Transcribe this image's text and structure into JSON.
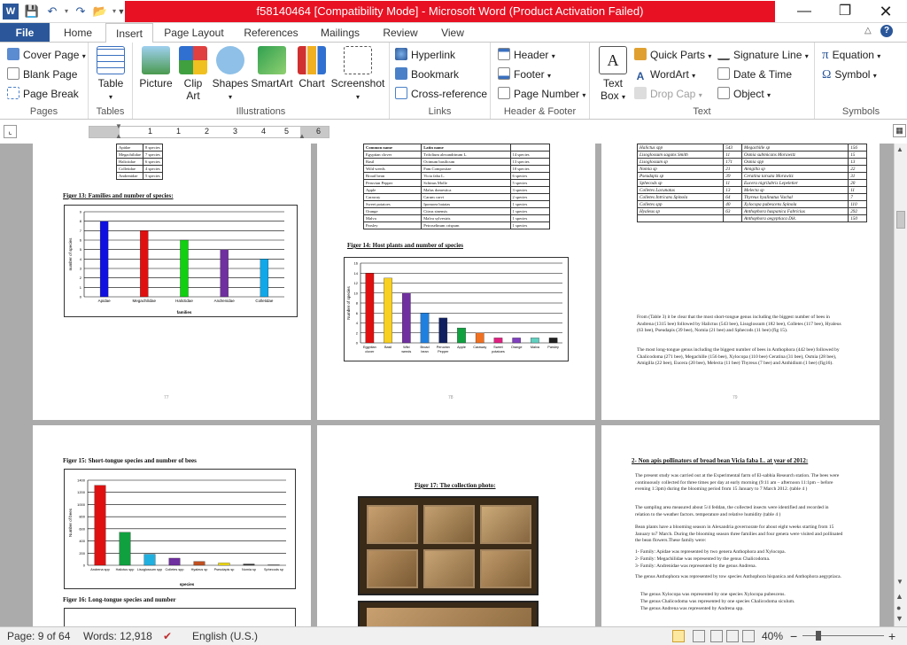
{
  "window": {
    "title": "f58140464 [Compatibility Mode]  -  Microsoft Word (Product Activation Failed)"
  },
  "tabs": {
    "file": "File",
    "items": [
      "Home",
      "Insert",
      "Page Layout",
      "References",
      "Mailings",
      "Review",
      "View"
    ],
    "active": "Insert"
  },
  "ribbon": {
    "pages": {
      "label": "Pages",
      "cover": "Cover Page",
      "blank": "Blank Page",
      "break": "Page Break"
    },
    "tables": {
      "label": "Tables",
      "table": "Table"
    },
    "illustrations": {
      "label": "Illustrations",
      "picture": "Picture",
      "clipart1": "Clip",
      "clipart2": "Art",
      "shapes": "Shapes",
      "smartart": "SmartArt",
      "chart": "Chart",
      "screenshot": "Screenshot"
    },
    "links": {
      "label": "Links",
      "hyperlink": "Hyperlink",
      "bookmark": "Bookmark",
      "crossref": "Cross-reference"
    },
    "headerfooter": {
      "label": "Header & Footer",
      "header": "Header",
      "footer": "Footer",
      "pagenumber": "Page Number"
    },
    "text": {
      "label": "Text",
      "textbox1": "Text",
      "textbox2": "Box",
      "quickparts": "Quick Parts",
      "wordart": "WordArt",
      "dropcap": "Drop Cap",
      "signature": "Signature Line",
      "datetime": "Date & Time",
      "object": "Object"
    },
    "symbols": {
      "label": "Symbols",
      "equation": "Equation",
      "symbol": "Symbol"
    }
  },
  "ruler": {
    "ticks": [
      "1",
      "1",
      "2",
      "3",
      "4",
      "5",
      "6"
    ]
  },
  "status": {
    "page": "Page: 9 of 64",
    "words": "Words: 12,918",
    "language": "English (U.S.)",
    "zoom": "40%"
  },
  "colors": {
    "accent": "#2b579a",
    "titlebar_alert": "#e81123"
  },
  "document": {
    "page1": {
      "fam_rows": [
        [
          "Apidae",
          "8 species"
        ],
        [
          "Megachilidae",
          "7 species"
        ],
        [
          "Halictidae",
          "6 species"
        ],
        [
          "Colletidae",
          "4 species"
        ],
        [
          "Andrenidae",
          "5 species"
        ]
      ],
      "fig13": "Figer  13: Families and number of species:",
      "fig13_y": "number of species",
      "fig13_x": "families",
      "num": "77"
    },
    "page2": {
      "table_head": [
        "Common  name",
        "Latin name",
        ""
      ],
      "table_rows": [
        [
          "Egyptian clover",
          "Trifolium alexandrinum L.",
          "14 species"
        ],
        [
          "Basil",
          "Ocimum basilicum",
          "13 species"
        ],
        [
          "Wild weeds",
          "Fam.Compositae",
          "10 species"
        ],
        [
          "Broad bean",
          "Vicia faba L.",
          "6 species"
        ],
        [
          "Peruvian Pepper",
          "Schinus Molle",
          "5 species"
        ],
        [
          "Apple",
          "Malus domestica",
          "3 species"
        ],
        [
          "Caraway",
          "Carum carvi",
          "2 species"
        ],
        [
          "Sweet potatoes",
          "Ipomoea batatas",
          "1 species"
        ],
        [
          "Orange",
          "Citrus sinensis",
          "1 species"
        ],
        [
          "Malva",
          "Malva sylvestris",
          "1 species"
        ],
        [
          "Parsley",
          "Petroselinum crispum",
          "1 species"
        ]
      ],
      "fig14": "Figer  14: Host plants and number of species",
      "fig14_y": "Number of species",
      "num": "78"
    },
    "page3": {
      "rows": [
        [
          "Halictus spp",
          "543",
          "Megachille sp",
          "156"
        ],
        [
          "Lisoglossum sagans  Smith",
          "11",
          "Osmia submicans  Morawitz",
          "15"
        ],
        [
          "Lisoglossum sp",
          "171",
          "Osmia spp",
          "13"
        ],
        [
          "Nomia sp",
          "21",
          "Amigilla sp",
          "22"
        ],
        [
          "Pseudapis sp",
          "39",
          "Ceratina tarsata  Morawitz",
          "31"
        ],
        [
          "Sphecods sp",
          "11",
          "Eucera nigrilabris Lepeletier",
          "20"
        ],
        [
          "Colletes Lacunatus",
          "13",
          "Melecta sp",
          "11"
        ],
        [
          "Colletes Intricans Spinola",
          "64",
          "Thyreus  hyalinatus  Vachal",
          "7"
        ],
        [
          "Colletes spp",
          "40",
          "Xylocopa pubescens  Spinola",
          "110"
        ],
        [
          "Hyaleus sp",
          "63",
          "Anthophora haspanica  Fabricius",
          "292"
        ],
        [
          "",
          "",
          "Anthophora aegyptiaca   Dik.",
          "150"
        ]
      ],
      "para1": "From (Table 3) it be clear that the most short-tongue genus including the biggest number of bees in Andrena (1315 bee) followed by Halictus (543 bee), Lisoglossum (182 bee), Colletes (117 bee), Hyaleus (63 bee), Pseudapis (39 bee), Nomia (21 bee) and Sphecods (11 bee) (fig 15).",
      "para2": "The most long-tongue genus including the biggest number of bees in Anthophora (442 bee) followed by Chalicodoma (271 bee), Megachille (156 bee), Xylocopa (110 bee) Ceratina (31 bee), Osmia (28 bee), Amigilla (22 bee), Eucera (20 bee), Melecta (11 bee) Thyreus (7 bee) and Anthidium (1 bee) (fig16).",
      "num": "79"
    },
    "page4": {
      "fig15": "Figer  15: Short-tongue species and number of bees",
      "fig15_y": "Number of bees",
      "fig15_x": "species",
      "fig16": "Figer  16: Long-tongue species and number"
    },
    "page5": {
      "fig17": "Figer 17: The collection photo:"
    },
    "page6": {
      "heading": "2- Non apis pollinators of broad bean Vicia faba L. at year of 2012:",
      "p1": "The present study was carried out at the Experimental farm of El-sabhia Research station. The bees were continuously collected for three times per day at early morning (9:11 am – afternoon 11:1pm – before evening 1:3pm) during the blooming period from 15 January to 7 March 2012. (table 4 )",
      "p2": "The sampling area measured about 5/4 feddan, the collected insects were identified and recorded in relation to the weather factors. temperature and relative humidity (table 4 )",
      "p3": "Bean plants have a blooming season in Alexandria governorate for about eight weeks starting from 15 January to7 March. During the blooming season three families and four genera were visited and pollinated the bean flowers.These family were:",
      "l1": "1-  Family: Apidae was represented by two genera  Anthophora and  Xylocopa.",
      "l2": "2-  Family: Megachilidae was represented by the genus Chalicodoma.",
      "l3": "3-  Family: Andrenidae was represented by the genus Andrena.",
      "p4": "The genus Anthophora was represented by tow species Anthophora hispanica and Anthophora aegyptiaca.",
      "b1": "The genus Xylocopa was represented by one species Xylocopa pubescens.",
      "b2": "The genus Chalicodoma was represented by one species Chalicodoma siculum.",
      "b3": "The genus Andrena was represented by Andrena spp."
    }
  },
  "chart_data": [
    {
      "type": "bar",
      "title": "",
      "categories": [
        "Apidae",
        "Megachilidae",
        "Halictidae",
        "Andrenidae",
        "Colletidae"
      ],
      "values": [
        8,
        7,
        6,
        5,
        4
      ],
      "ylim": [
        0,
        9
      ],
      "xlabel": "families",
      "ylabel": "number of species",
      "colors": [
        "#1010e0",
        "#e01010",
        "#10d010",
        "#7030a0",
        "#10a8e8"
      ]
    },
    {
      "type": "bar",
      "title": "",
      "categories": [
        "Egyptian clover",
        "Basil",
        "Wild weeds",
        "Broad bean",
        "Peruvian Pepper",
        "Apple",
        "Caraway",
        "Sweet potatoes",
        "Orange",
        "Malva",
        "Parsley"
      ],
      "values": [
        14,
        13,
        10,
        6,
        5,
        3,
        2,
        1,
        1,
        1,
        1
      ],
      "ylim": [
        0,
        16
      ],
      "xlabel": "",
      "ylabel": "Number of species",
      "colors": [
        "#e01010",
        "#f8d020",
        "#7030a0",
        "#2080e0",
        "#102060",
        "#10a040",
        "#f07020",
        "#e02080",
        "#8040c0",
        "#60d0c0",
        "#202020"
      ]
    },
    {
      "type": "bar",
      "title": "",
      "categories": [
        "Andrena spp",
        "Halictus spp",
        "Lisoglossum spp",
        "Colletes spp",
        "Hyaleus sp",
        "Pseudapis sp",
        "Nomia sp",
        "Sphecods sp"
      ],
      "values": [
        1315,
        543,
        182,
        117,
        63,
        39,
        21,
        11
      ],
      "ylim": [
        0,
        1400
      ],
      "xlabel": "species",
      "ylabel": "Number of bees",
      "colors": [
        "#e01010",
        "#10a040",
        "#20b0e0",
        "#7030a0",
        "#c05020",
        "#f8e010",
        "#303030",
        "#a0a0a0"
      ]
    }
  ]
}
